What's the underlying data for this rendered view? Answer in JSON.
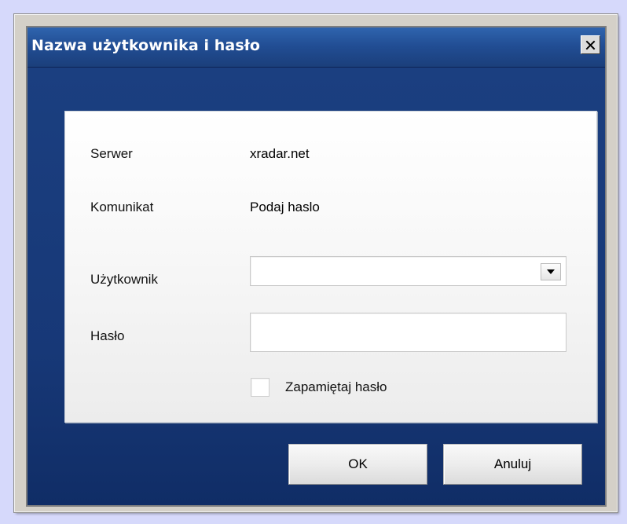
{
  "dialog": {
    "title": "Nazwa użytkownika i hasło"
  },
  "details": {
    "server_label": "Serwer",
    "server_value": "xradar.net",
    "message_label": "Komunikat",
    "message_value": "Podaj haslo"
  },
  "form": {
    "user_label": "Użytkownik",
    "user_value": "",
    "password_label": "Hasło",
    "password_value": "",
    "remember_label": "Zapamiętaj hasło",
    "remember_checked": false
  },
  "buttons": {
    "ok": "OK",
    "cancel": "Anuluj"
  },
  "icons": {
    "close": "close-icon",
    "dropdown": "chevron-down-icon"
  },
  "colors": {
    "page_background": "#d6d9fb",
    "title_bar": "#214d93",
    "dialog_background": "#163875",
    "panel_background": "#f7f7f7"
  }
}
